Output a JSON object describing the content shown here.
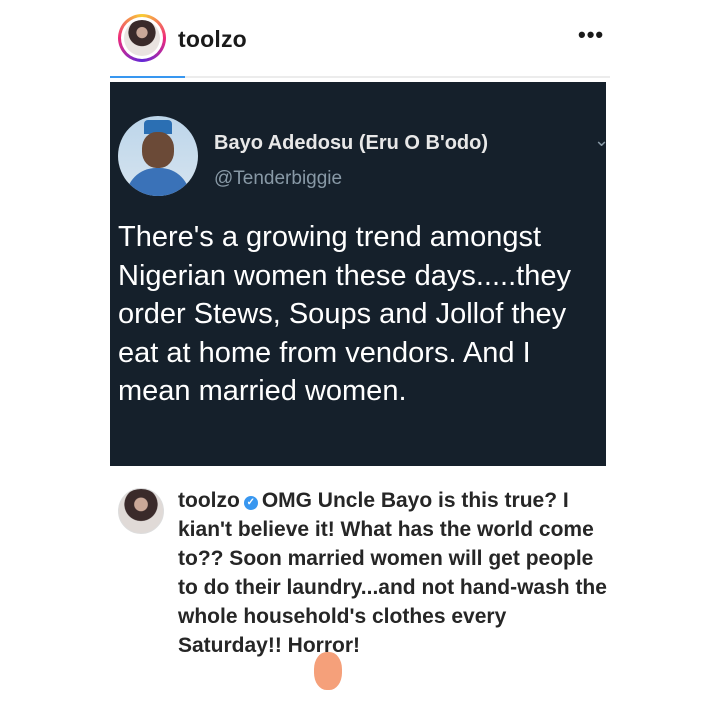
{
  "post": {
    "username": "toolzo",
    "more_label": "•••",
    "progress": 0.15
  },
  "tweet": {
    "display_name": "Bayo Adedosu (Eru O B'odo)",
    "handle": "@Tenderbiggie",
    "text": "There's a growing trend amongst Nigerian women these days.....they order Stews, Soups and Jollof they eat at home from vendors. And I mean married women.",
    "caret": "⌄"
  },
  "caption": {
    "username": "toolzo",
    "text": "OMG Uncle Bayo is this true? I kian't believe it! What has the world come to?? Soon married women will get people to do their laundry...and not hand-wash the whole household's clothes every Saturday!! Horror!"
  },
  "colors": {
    "tweet_bg": "#15202b",
    "verified": "#3897f0"
  }
}
